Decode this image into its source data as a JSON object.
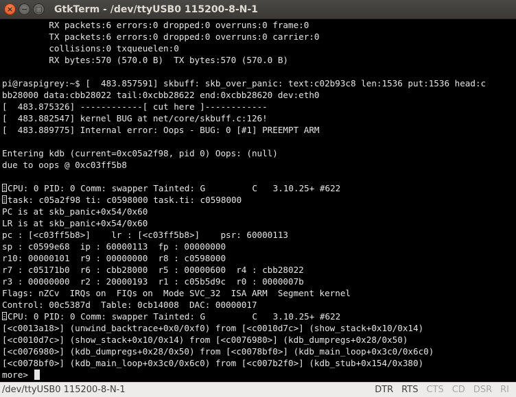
{
  "window": {
    "title": "GtkTerm - /dev/ttyUSB0  115200-8-N-1",
    "close_glyph": "×",
    "minimize_glyph": "−",
    "maximize_glyph": "□"
  },
  "terminal": {
    "lines": [
      "         RX packets:6 errors:0 dropped:0 overruns:0 frame:0",
      "         TX packets:6 errors:0 dropped:0 overruns:0 carrier:0",
      "         collisions:0 txqueuelen:0",
      "         RX bytes:570 (570.0 B)  TX bytes:570 (570.0 B)",
      "",
      "pi@raspigrey:~$ [  483.857591] skbuff: skb_over_panic: text:c02b93c8 len:1536 put:1536 head:c",
      "bb28000 data:cbb28022 tail:0xcbb28622 end:0xcbb28620 dev:eth0",
      "[  483.875326] ------------[ cut here ]------------",
      "[  483.882547] kernel BUG at net/core/skbuff.c:126!",
      "[  483.889775] Internal error: Oops - BUG: 0 [#1] PREEMPT ARM",
      "",
      "Entering kdb (current=0xc05a2f98, pid 0) Oops: (null)",
      "due to oops @ 0xc03ff5b8",
      "",
      "CPU: 0 PID: 0 Comm: swapper Tainted: G         C   3.10.25+ #622",
      "task: c05a2f98 ti: c0598000 task.ti: c0598000",
      "PC is at skb_panic+0x54/0x60",
      "LR is at skb_panic+0x54/0x60",
      "pc : [<c03ff5b8>]    lr : [<c03ff5b8>]    psr: 60000113",
      "sp : c0599e68  ip : 60000113  fp : 00000000",
      "r10: 00000101  r9 : 00000000  r8 : c0598000",
      "r7 : c05171b0  r6 : cbb28000  r5 : 00000600  r4 : cbb28022",
      "r3 : 00000000  r2 : 20000193  r1 : c05b5d9c  r0 : 0000007b",
      "Flags: nZCv  IRQs on  FIQs on  Mode SVC_32  ISA ARM  Segment kernel",
      "Control: 00c5387d  Table: 0cb14008  DAC: 00000017",
      "CPU: 0 PID: 0 Comm: swapper Tainted: G         C   3.10.25+ #622",
      "[<c0013a18>] (unwind_backtrace+0x0/0xf0) from [<c0010d7c>] (show_stack+0x10/0x14)",
      "[<c0010d7c>] (show_stack+0x10/0x14) from [<c0076980>] (kdb_dumpregs+0x28/0x50)",
      "[<c0076980>] (kdb_dumpregs+0x28/0x50) from [<c0078bf0>] (kdb_main_loop+0x3c0/0x6c0)",
      "[<c0078bf0>] (kdb_main_loop+0x3c0/0x6c0) from [<c007b2f0>] (kdb_stub+0x154/0x380)",
      "more> "
    ],
    "glyph_lines": [
      14,
      15,
      25
    ],
    "cursor_line": 30
  },
  "statusbar": {
    "port": "/dev/ttyUSB0  115200-8-N-1",
    "signals": [
      {
        "label": "DTR",
        "active": true
      },
      {
        "label": "RTS",
        "active": true
      },
      {
        "label": "CTS",
        "active": false
      },
      {
        "label": "CD",
        "active": false
      },
      {
        "label": "DSR",
        "active": false
      },
      {
        "label": "RI",
        "active": false
      }
    ]
  },
  "colors": {
    "terminal_bg": "#000000",
    "terminal_fg": "#e6e6e6",
    "titlebar_bg": "#3c3b37",
    "close_button": "#df4a16",
    "status_active": "#3c3c3c",
    "status_inactive": "#a8a6a2"
  }
}
